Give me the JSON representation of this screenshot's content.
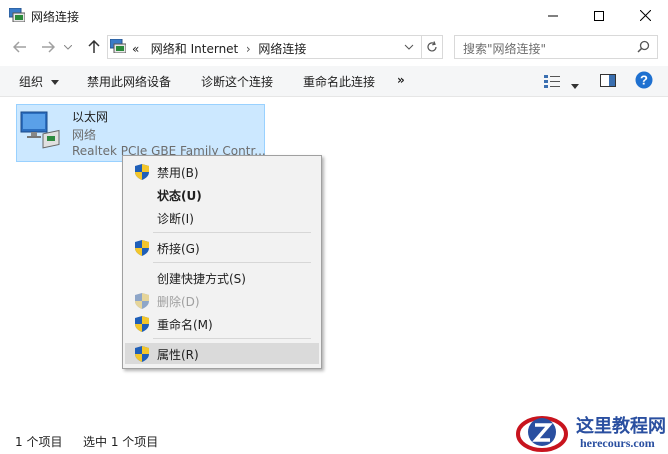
{
  "window": {
    "title": "网络连接",
    "icons": {
      "app": "network-connections-icon",
      "minimize": "minimize-icon",
      "maximize": "maximize-icon",
      "close": "close-icon"
    }
  },
  "nav": {
    "breadcrumb_prefix": "«",
    "breadcrumb": [
      "网络和 Internet",
      "网络连接"
    ],
    "breadcrumb_sep": "›",
    "search_placeholder": "搜索\"网络连接\""
  },
  "commands": {
    "organize": "组织",
    "disable_device": "禁用此网络设备",
    "diagnose": "诊断这个连接",
    "rename": "重命名此连接",
    "more": "»"
  },
  "item": {
    "name": "以太网",
    "status": "网络",
    "device": "Realtek PCIe GBE Family Contr..."
  },
  "context_menu": {
    "items": [
      {
        "label": "禁用(B)",
        "shield": true
      },
      {
        "label": "状态(U)",
        "bold": true
      },
      {
        "label": "诊断(I)"
      },
      {
        "label": "桥接(G)",
        "shield": true
      },
      {
        "label": "创建快捷方式(S)"
      },
      {
        "label": "删除(D)",
        "shield": true,
        "disabled": true
      },
      {
        "label": "重命名(M)",
        "shield": true
      },
      {
        "label": "属性(R)",
        "shield": true,
        "highlighted": true
      }
    ]
  },
  "statusbar": {
    "count": "1 个项目",
    "selected": "选中 1 个项目"
  },
  "watermark": {
    "title": "这里教程网",
    "url": "herecours.com"
  },
  "colors": {
    "selection_bg": "#cce8ff",
    "selection_border": "#99d1ff",
    "help_blue": "#1e70d0",
    "watermark_red": "#c8141e"
  }
}
